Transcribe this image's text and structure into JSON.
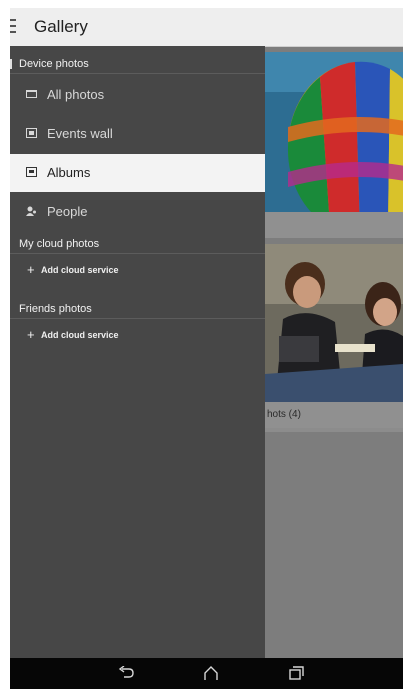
{
  "app": {
    "title": "Gallery"
  },
  "drawer": {
    "device_section": "Device photos",
    "items": [
      {
        "label": "All photos",
        "icon": "photos-icon",
        "active": false
      },
      {
        "label": "Events wall",
        "icon": "events-wall-icon",
        "active": false
      },
      {
        "label": "Albums",
        "icon": "albums-icon",
        "active": true
      },
      {
        "label": "People",
        "icon": "people-icon",
        "active": false
      }
    ],
    "cloud_section": "My cloud photos",
    "cloud_add": "Add cloud service",
    "friends_section": "Friends photos",
    "friends_add": "Add cloud service"
  },
  "background": {
    "album2_caption": "hots (4)"
  },
  "navbar": {
    "back_icon": "back-icon",
    "home_icon": "home-icon",
    "recents_icon": "recents-icon"
  },
  "colors": {
    "drawer_bg": "#474747",
    "active_item_bg": "#f3f3f3",
    "actionbar_bg": "#eeeeee",
    "navbar_bg": "#060606"
  }
}
